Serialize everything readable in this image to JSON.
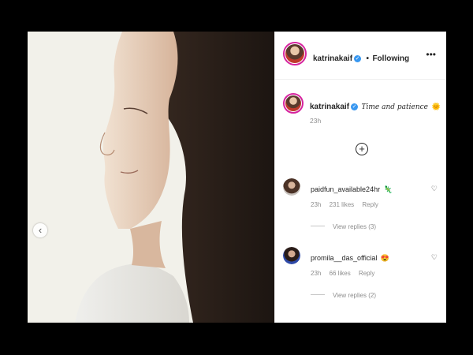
{
  "post": {
    "username": "katrinakaif",
    "follow_separator": "•",
    "follow_status": "Following",
    "more_icon": "more-horizontal-icon"
  },
  "caption": {
    "username": "katrinakaif",
    "text": "Time and patience",
    "emoji": "🌞",
    "time": "23h"
  },
  "load_more_icon": "plus-circle-icon",
  "comments": [
    {
      "username": "paidfun_available24hr",
      "emoji": "🦎",
      "time": "23h",
      "likes": "231 likes",
      "reply_label": "Reply",
      "view_replies": "View replies (3)"
    },
    {
      "username": "promila__das_official",
      "emoji": "😍",
      "time": "23h",
      "likes": "66 likes",
      "reply_label": "Reply",
      "view_replies": "View replies (2)"
    }
  ],
  "colors": {
    "accent": "#3897f0",
    "story_ring": "#d6249f",
    "muted": "#8e8e8e"
  }
}
